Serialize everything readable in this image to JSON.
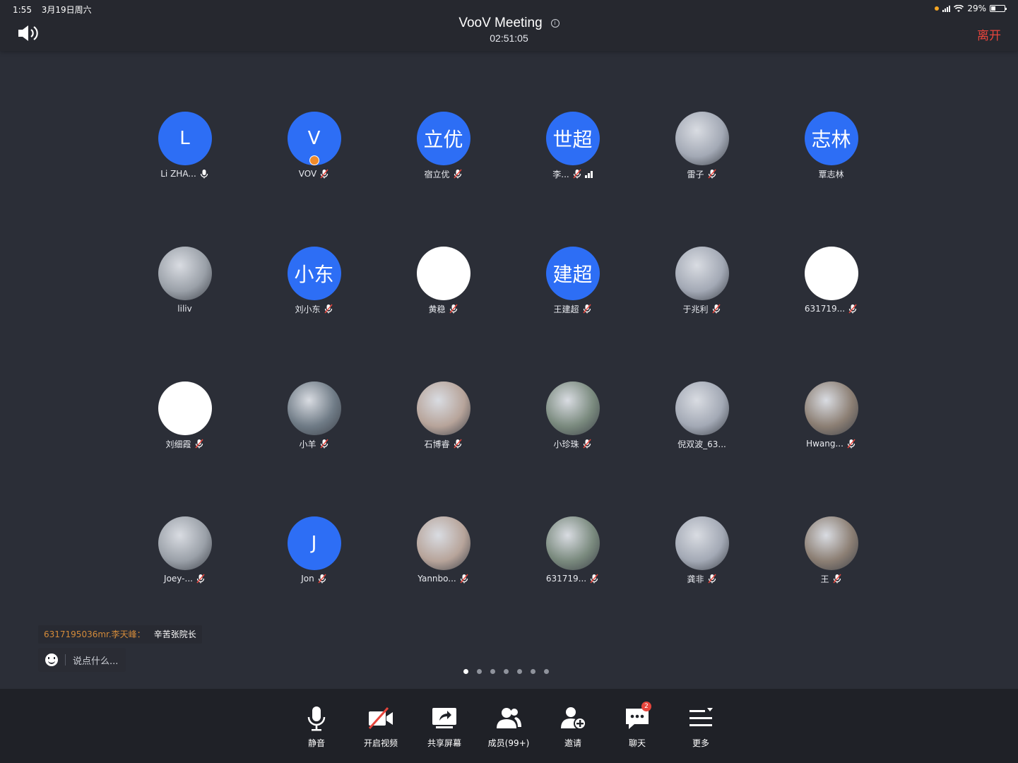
{
  "status_bar": {
    "time": "1:55",
    "date": "3月19日周六",
    "battery": "29%"
  },
  "header": {
    "title": "VooV Meeting",
    "timer": "02:51:05",
    "leave_label": "离开"
  },
  "colors": {
    "background": "#2b2e37",
    "avatar_blue": "#2d6ef5",
    "leave_red": "#e8453c",
    "chat_sender": "#d48b3a"
  },
  "participants": [
    {
      "name": "Li ZHA...",
      "initial": "L",
      "avatar": "blue",
      "mic": "on"
    },
    {
      "name": "VOV",
      "initial": "V",
      "avatar": "blue",
      "mic": "muted",
      "host_badge": true
    },
    {
      "name": "宿立优",
      "initial": "立优",
      "avatar": "blue",
      "mic": "muted"
    },
    {
      "name": "李...",
      "initial": "世超",
      "avatar": "blue",
      "mic": "muted",
      "signal_bars": true
    },
    {
      "name": "雷子",
      "initial": "",
      "avatar": "photo",
      "mic": "muted"
    },
    {
      "name": "覃志林",
      "initial": "志林",
      "avatar": "blue",
      "mic": "none"
    },
    {
      "name": "liliv",
      "initial": "",
      "avatar": "photo",
      "mic": "none"
    },
    {
      "name": "刘小东",
      "initial": "小东",
      "avatar": "blue",
      "mic": "muted"
    },
    {
      "name": "黄稳",
      "initial": "",
      "avatar": "white",
      "mic": "muted"
    },
    {
      "name": "王建超",
      "initial": "建超",
      "avatar": "blue",
      "mic": "muted"
    },
    {
      "name": "于兆利",
      "initial": "",
      "avatar": "photo",
      "mic": "muted"
    },
    {
      "name": "631719...",
      "initial": "",
      "avatar": "white",
      "mic": "muted"
    },
    {
      "name": "刘细霞",
      "initial": "",
      "avatar": "white",
      "mic": "muted"
    },
    {
      "name": "小羊",
      "initial": "",
      "avatar": "photo",
      "mic": "muted"
    },
    {
      "name": "石博睿",
      "initial": "",
      "avatar": "photo",
      "mic": "muted"
    },
    {
      "name": "小珍珠",
      "initial": "",
      "avatar": "photo",
      "mic": "muted"
    },
    {
      "name": "倪双波_63...",
      "initial": "",
      "avatar": "photo",
      "mic": "none"
    },
    {
      "name": "Hwang...",
      "initial": "",
      "avatar": "photo",
      "mic": "muted"
    },
    {
      "name": "Joey-...",
      "initial": "",
      "avatar": "photo",
      "mic": "muted"
    },
    {
      "name": "Jon",
      "initial": "J",
      "avatar": "blue",
      "mic": "muted"
    },
    {
      "name": "Yannbo...",
      "initial": "",
      "avatar": "photo",
      "mic": "muted"
    },
    {
      "name": "631719...",
      "initial": "",
      "avatar": "photo",
      "mic": "muted"
    },
    {
      "name": "龚非",
      "initial": "",
      "avatar": "photo",
      "mic": "muted"
    },
    {
      "name": "王",
      "initial": "",
      "avatar": "photo",
      "mic": "muted"
    }
  ],
  "chat": {
    "sender": "6317195036mr.李天峰：",
    "message": "辛苦张院长",
    "input_placeholder": "说点什么..."
  },
  "pager": {
    "pages": 7,
    "current": 1
  },
  "toolbar": {
    "mute": "静音",
    "video": "开启视频",
    "share": "共享屏幕",
    "members": "成员(99+)",
    "invite": "邀请",
    "chat": "聊天",
    "chat_badge": "2",
    "more": "更多"
  }
}
